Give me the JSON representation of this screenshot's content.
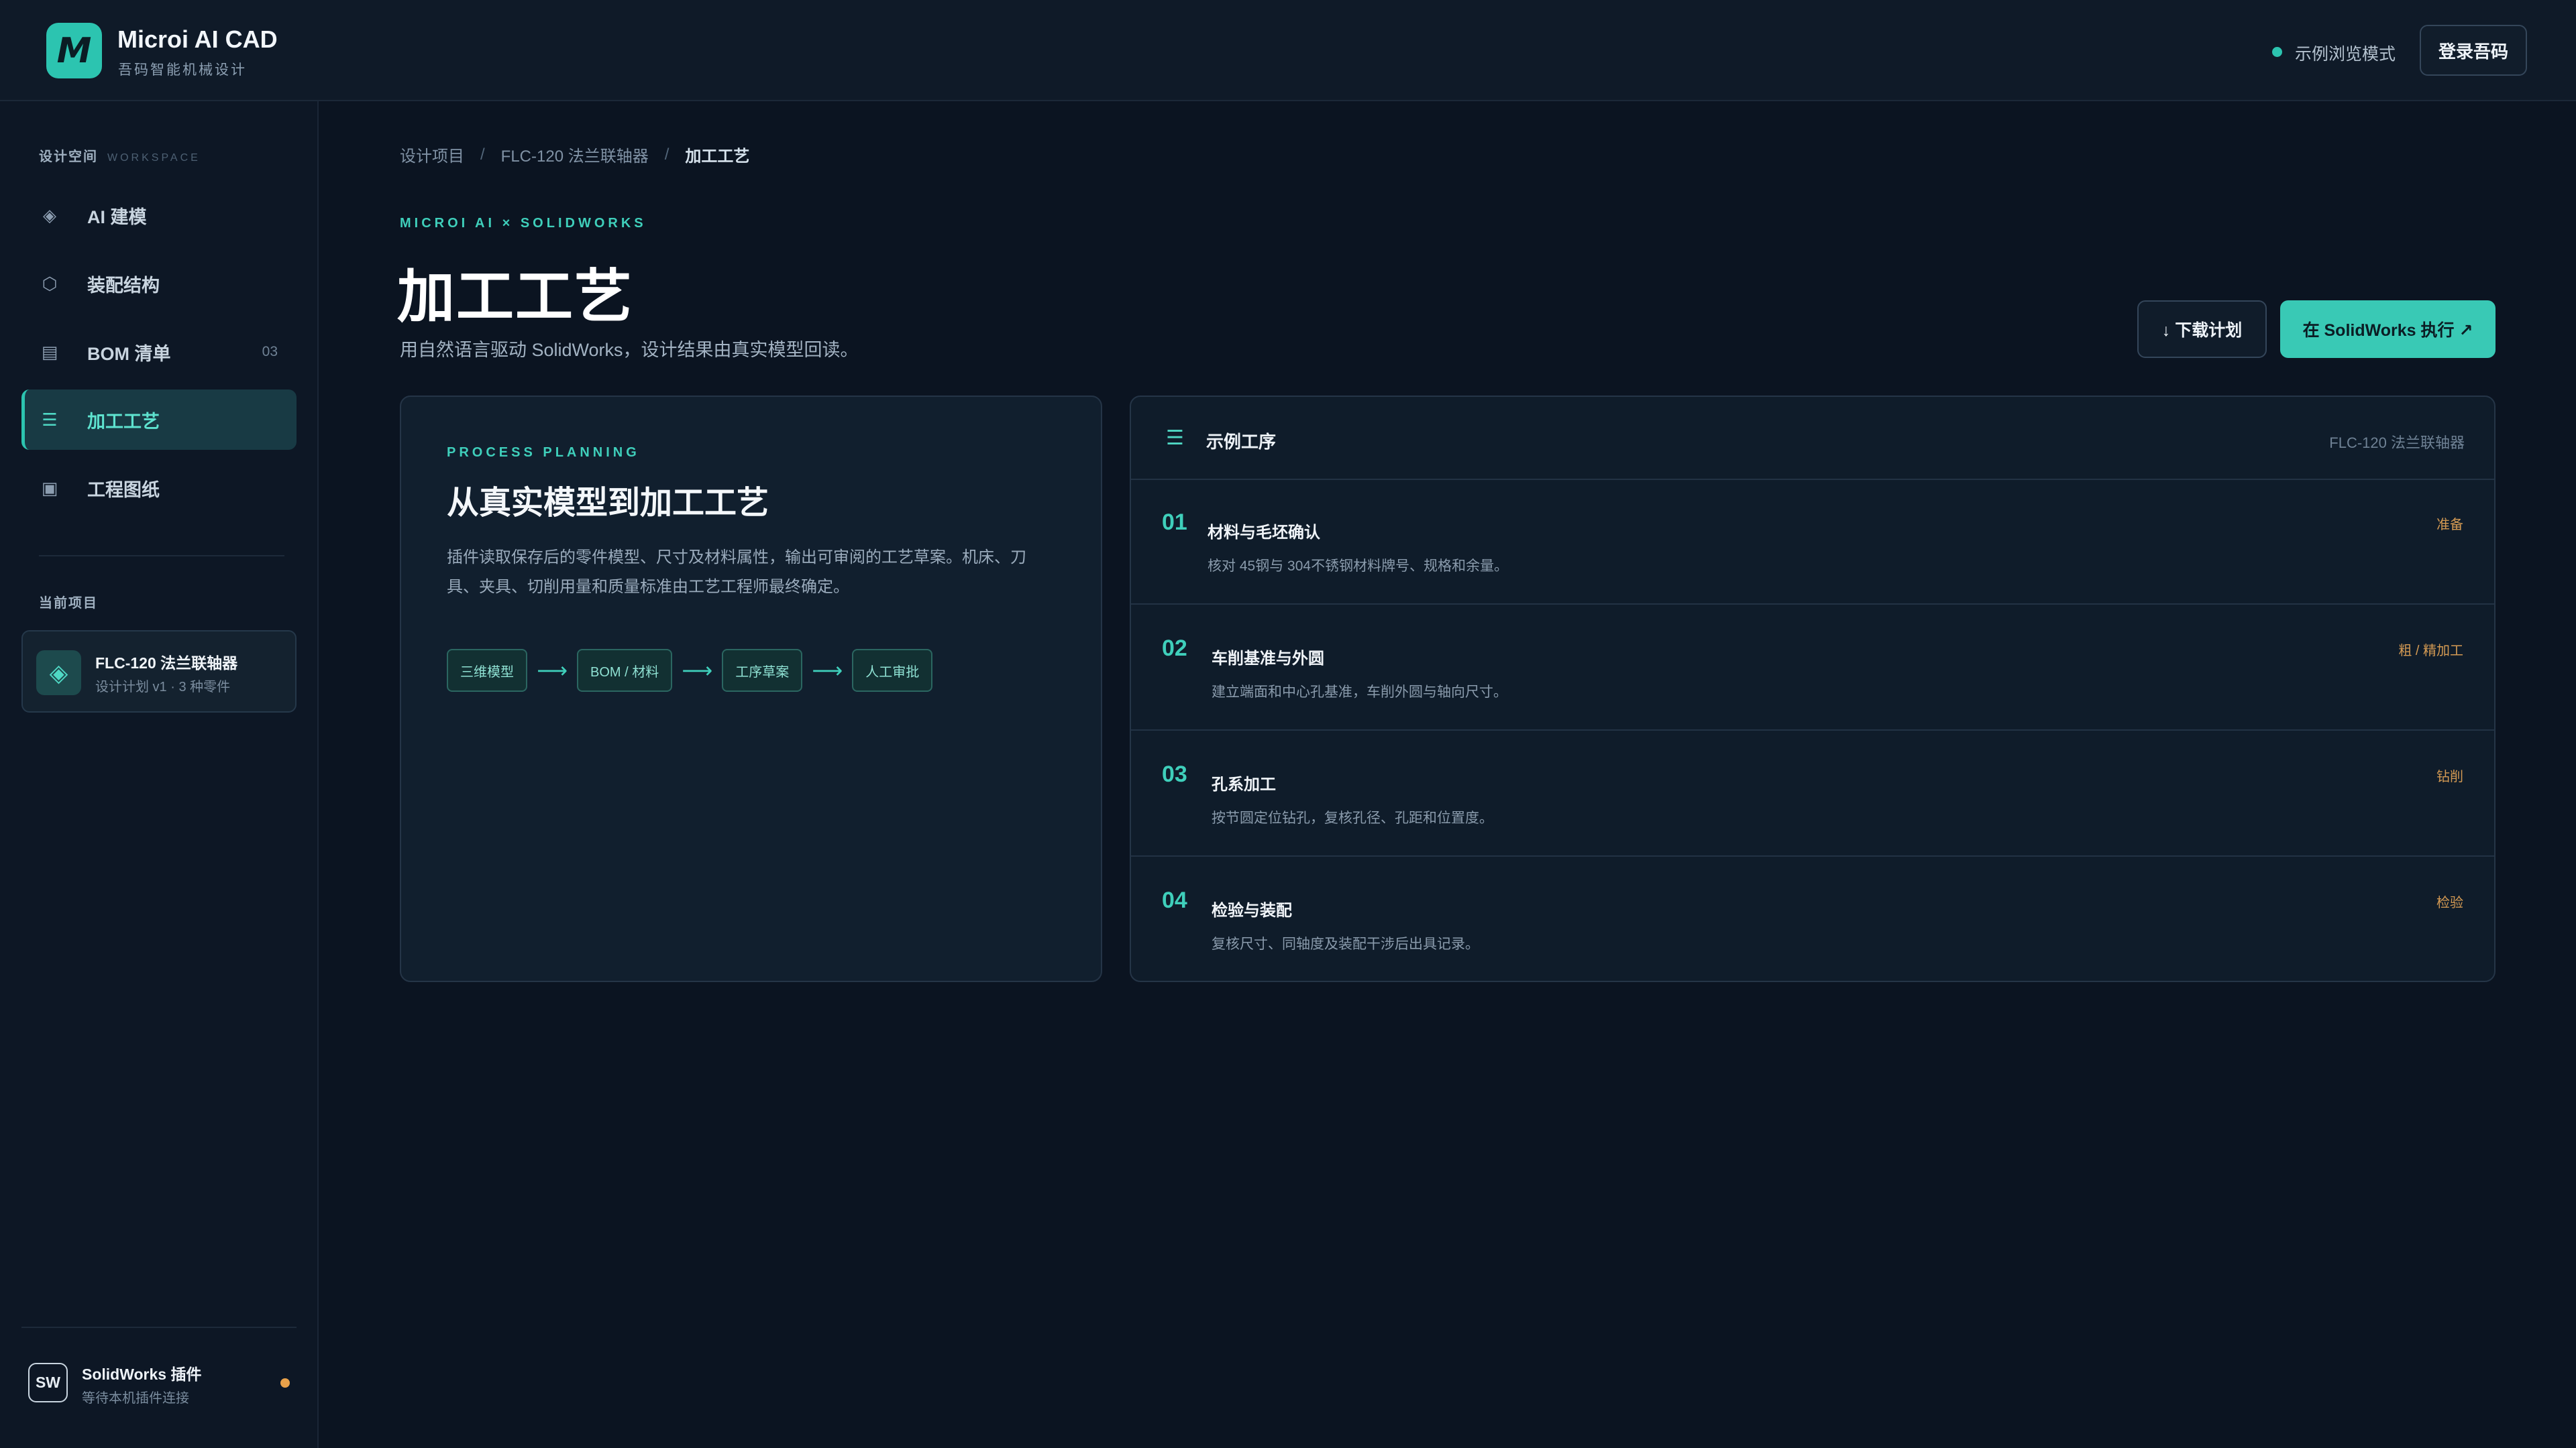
{
  "app": {
    "logo_letter": "M",
    "title": "Microi AI CAD",
    "subtitle": "吾码智能机械设计"
  },
  "topbar": {
    "mode_label": "示例浏览模式",
    "login_label": "登录吾码"
  },
  "sidebar": {
    "section_title": "设计空间",
    "section_title_en": "WORKSPACE",
    "items": [
      {
        "label": "AI 建模",
        "icon": "diamond-icon",
        "glyph": "◈",
        "count": ""
      },
      {
        "label": "装配结构",
        "icon": "hexagon-icon",
        "glyph": "⬡",
        "count": ""
      },
      {
        "label": "BOM 清单",
        "icon": "list-table-icon",
        "glyph": "▤",
        "count": "03"
      },
      {
        "label": "加工工艺",
        "icon": "process-list-icon",
        "glyph": "☰",
        "count": "",
        "active": true
      },
      {
        "label": "工程图纸",
        "icon": "drawing-icon",
        "glyph": "▣",
        "count": ""
      }
    ],
    "current_project_title": "当前项目",
    "project": {
      "icon": "diamond-icon",
      "glyph": "◈",
      "name": "FLC-120 法兰联轴器",
      "meta": "设计计划 v1 · 3 种零件"
    },
    "plugin": {
      "badge": "SW",
      "title": "SolidWorks 插件",
      "status": "等待本机插件连接",
      "status_color": "#e8a14a"
    }
  },
  "breadcrumb": {
    "items": [
      "设计项目",
      "FLC-120 法兰联轴器",
      "加工工艺"
    ],
    "separator": "/"
  },
  "header": {
    "eyebrow": "MICROI AI × SOLIDWORKS",
    "title": "加工工艺",
    "description": "用自然语言驱动 SolidWorks，设计结果由真实模型回读。",
    "download_label": "↓ 下载计划",
    "execute_label": "在 SolidWorks 执行 ↗"
  },
  "planning": {
    "eyebrow": "PROCESS PLANNING",
    "title": "从真实模型到加工工艺",
    "description": "插件读取保存后的零件模型、尺寸及材料属性，输出可审阅的工艺草案。机床、刀具、夹具、切削用量和质量标准由工艺工程师最终确定。",
    "flow": [
      "三维模型",
      "BOM / 材料",
      "工序草案",
      "人工审批"
    ],
    "arrow": "⟶"
  },
  "steps_panel": {
    "icon": "process-list-icon",
    "glyph": "☰",
    "title": "示例工序",
    "project": "FLC-120 法兰联轴器",
    "steps": [
      {
        "num": "01",
        "title": "材料与毛坯确认",
        "desc": "核对 45钢与 304不锈钢材料牌号、规格和余量。",
        "tag": "准备"
      },
      {
        "num": "02",
        "title": "车削基准与外圆",
        "desc": "建立端面和中心孔基准，车削外圆与轴向尺寸。",
        "tag": "粗 / 精加工"
      },
      {
        "num": "03",
        "title": "孔系加工",
        "desc": "按节圆定位钻孔，复核孔径、孔距和位置度。",
        "tag": "钻削"
      },
      {
        "num": "04",
        "title": "检验与装配",
        "desc": "复核尺寸、同轴度及装配干涉后出具记录。",
        "tag": "检验"
      }
    ]
  },
  "colors": {
    "accent": "#2cc4b0",
    "background": "#0b1421",
    "panel": "#111f2e",
    "tag": "#d49a53"
  }
}
